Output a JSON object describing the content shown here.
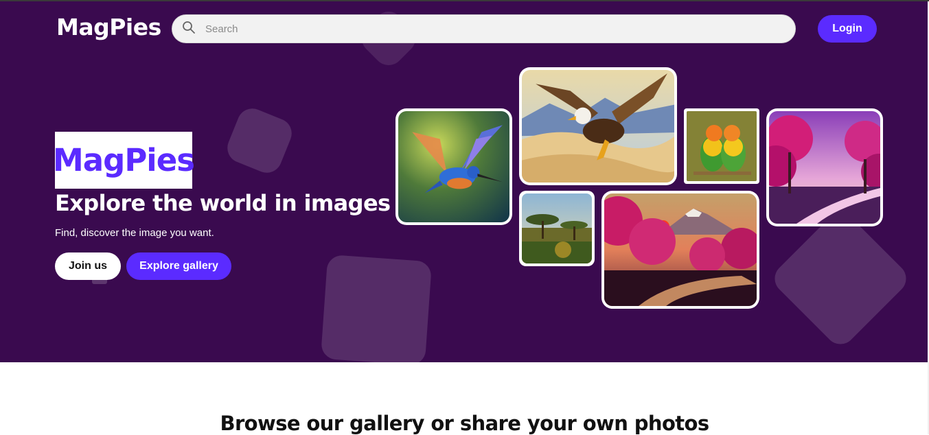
{
  "nav": {
    "logo": "MagPies",
    "search_placeholder": "Search",
    "login_label": "Login"
  },
  "hero": {
    "brand": "MagPies",
    "headline": "Explore the world in images",
    "subtitle": "Find, discover the image you want.",
    "join_label": "Join us",
    "explore_label": "Explore gallery",
    "gallery": [
      {
        "subject": "kingfisher"
      },
      {
        "subject": "eagle over desert"
      },
      {
        "subject": "lovebirds"
      },
      {
        "subject": "pink forest river"
      },
      {
        "subject": "savanna acacia"
      },
      {
        "subject": "mount fuji cherry blossoms"
      }
    ]
  },
  "section": {
    "heading": "Browse our gallery or share your own photos"
  },
  "colors": {
    "hero_bg": "#3a0a4f",
    "accent": "#5b2bff",
    "white": "#ffffff"
  }
}
